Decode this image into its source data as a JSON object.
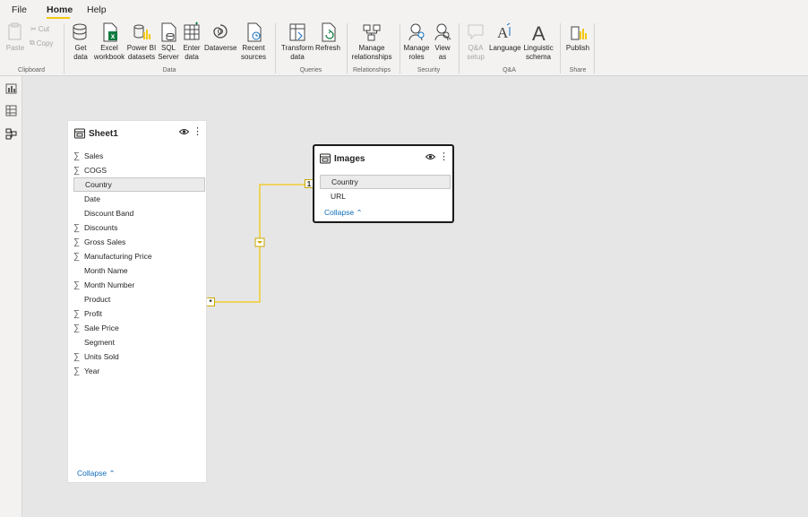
{
  "menu": {
    "tabs": [
      "File",
      "Home",
      "Help"
    ],
    "active": "Home"
  },
  "ribbon": {
    "clipboard": {
      "paste": "Paste",
      "cut": "Cut",
      "copy": "Copy",
      "group": "Clipboard"
    },
    "data": {
      "get_data": "Get\ndata",
      "excel": "Excel\nworkbook",
      "powerbi": "Power BI\ndatasets",
      "sql": "SQL\nServer",
      "enter": "Enter\ndata",
      "dataverse": "Dataverse",
      "recent": "Recent\nsources",
      "group": "Data"
    },
    "queries": {
      "transform": "Transform\ndata",
      "refresh": "Refresh",
      "group": "Queries"
    },
    "relationships": {
      "manage": "Manage\nrelationships",
      "group": "Relationships"
    },
    "security": {
      "roles": "Manage\nroles",
      "view": "View\nas",
      "group": "Security"
    },
    "qa": {
      "setup": "Q&A\nsetup",
      "language": "Language",
      "schema": "Linguistic\nschema",
      "group": "Q&A"
    },
    "share": {
      "publish": "Publish",
      "group": "Share"
    }
  },
  "tables": {
    "sheet1": {
      "name": "Sheet1",
      "fields": [
        {
          "label": "Sales",
          "sum": true
        },
        {
          "label": "COGS",
          "sum": true
        },
        {
          "label": "Country",
          "sum": false
        },
        {
          "label": "Date",
          "sum": false
        },
        {
          "label": "Discount Band",
          "sum": false
        },
        {
          "label": "Discounts",
          "sum": true
        },
        {
          "label": "Gross Sales",
          "sum": true
        },
        {
          "label": "Manufacturing Price",
          "sum": true
        },
        {
          "label": "Month Name",
          "sum": false
        },
        {
          "label": "Month Number",
          "sum": true
        },
        {
          "label": "Product",
          "sum": false
        },
        {
          "label": "Profit",
          "sum": true
        },
        {
          "label": "Sale Price",
          "sum": true
        },
        {
          "label": "Segment",
          "sum": false
        },
        {
          "label": "Units Sold",
          "sum": true
        },
        {
          "label": "Year",
          "sum": true
        }
      ],
      "collapse": "Collapse"
    },
    "images": {
      "name": "Images",
      "fields": [
        {
          "label": "Country",
          "sum": false
        },
        {
          "label": "URL",
          "sum": false
        }
      ],
      "collapse": "Collapse"
    }
  },
  "relationship": {
    "one_side": "1",
    "many_side": "*"
  }
}
